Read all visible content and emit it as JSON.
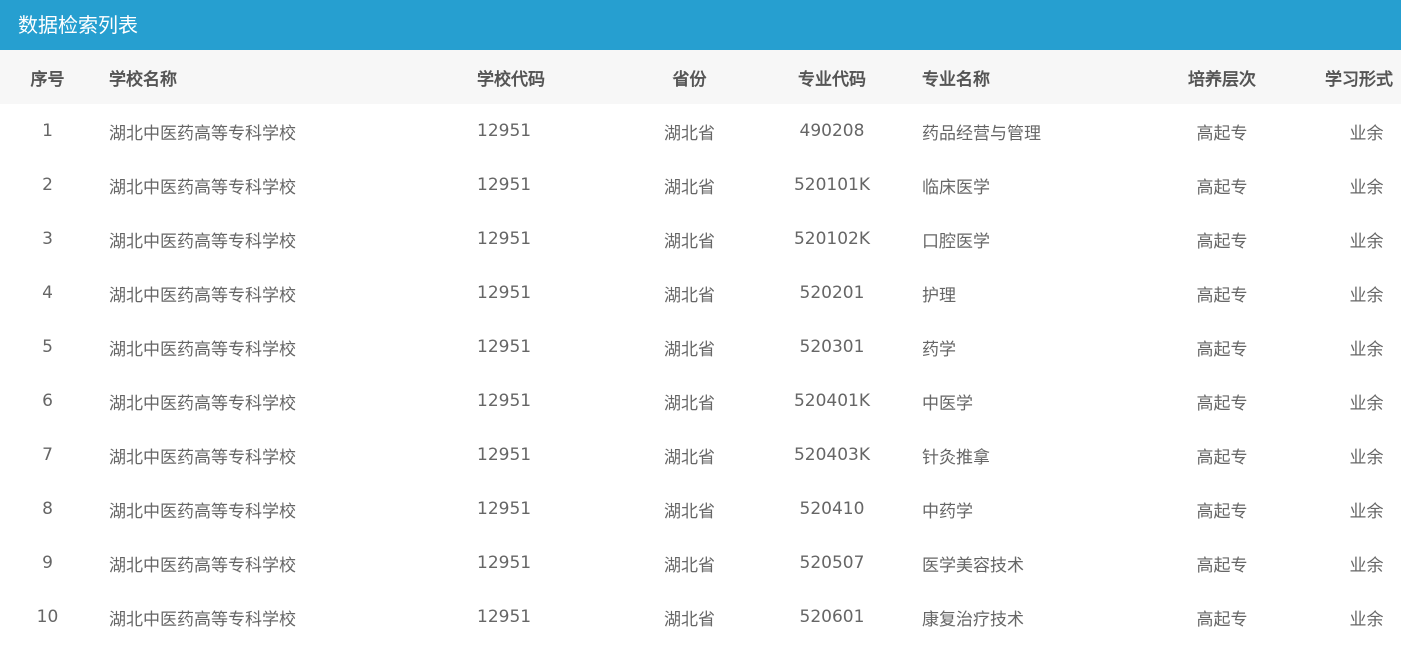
{
  "panel": {
    "title": "数据检索列表",
    "accent_color": "#269fd0"
  },
  "table": {
    "headers": {
      "seq": "序号",
      "school_name": "学校名称",
      "school_code": "学校代码",
      "province": "省份",
      "major_code": "专业代码",
      "major_name": "专业名称",
      "level": "培养层次",
      "study_mode": "学习形式"
    },
    "rows": [
      {
        "seq": "1",
        "school_name": "湖北中医药高等专科学校",
        "school_code": "12951",
        "province": "湖北省",
        "major_code": "490208",
        "major_name": "药品经营与管理",
        "level": "高起专",
        "study_mode": "业余"
      },
      {
        "seq": "2",
        "school_name": "湖北中医药高等专科学校",
        "school_code": "12951",
        "province": "湖北省",
        "major_code": "520101K",
        "major_name": "临床医学",
        "level": "高起专",
        "study_mode": "业余"
      },
      {
        "seq": "3",
        "school_name": "湖北中医药高等专科学校",
        "school_code": "12951",
        "province": "湖北省",
        "major_code": "520102K",
        "major_name": "口腔医学",
        "level": "高起专",
        "study_mode": "业余"
      },
      {
        "seq": "4",
        "school_name": "湖北中医药高等专科学校",
        "school_code": "12951",
        "province": "湖北省",
        "major_code": "520201",
        "major_name": "护理",
        "level": "高起专",
        "study_mode": "业余"
      },
      {
        "seq": "5",
        "school_name": "湖北中医药高等专科学校",
        "school_code": "12951",
        "province": "湖北省",
        "major_code": "520301",
        "major_name": "药学",
        "level": "高起专",
        "study_mode": "业余"
      },
      {
        "seq": "6",
        "school_name": "湖北中医药高等专科学校",
        "school_code": "12951",
        "province": "湖北省",
        "major_code": "520401K",
        "major_name": "中医学",
        "level": "高起专",
        "study_mode": "业余"
      },
      {
        "seq": "7",
        "school_name": "湖北中医药高等专科学校",
        "school_code": "12951",
        "province": "湖北省",
        "major_code": "520403K",
        "major_name": "针灸推拿",
        "level": "高起专",
        "study_mode": "业余"
      },
      {
        "seq": "8",
        "school_name": "湖北中医药高等专科学校",
        "school_code": "12951",
        "province": "湖北省",
        "major_code": "520410",
        "major_name": "中药学",
        "level": "高起专",
        "study_mode": "业余"
      },
      {
        "seq": "9",
        "school_name": "湖北中医药高等专科学校",
        "school_code": "12951",
        "province": "湖北省",
        "major_code": "520507",
        "major_name": "医学美容技术",
        "level": "高起专",
        "study_mode": "业余"
      },
      {
        "seq": "10",
        "school_name": "湖北中医药高等专科学校",
        "school_code": "12951",
        "province": "湖北省",
        "major_code": "520601",
        "major_name": "康复治疗技术",
        "level": "高起专",
        "study_mode": "业余"
      }
    ]
  }
}
